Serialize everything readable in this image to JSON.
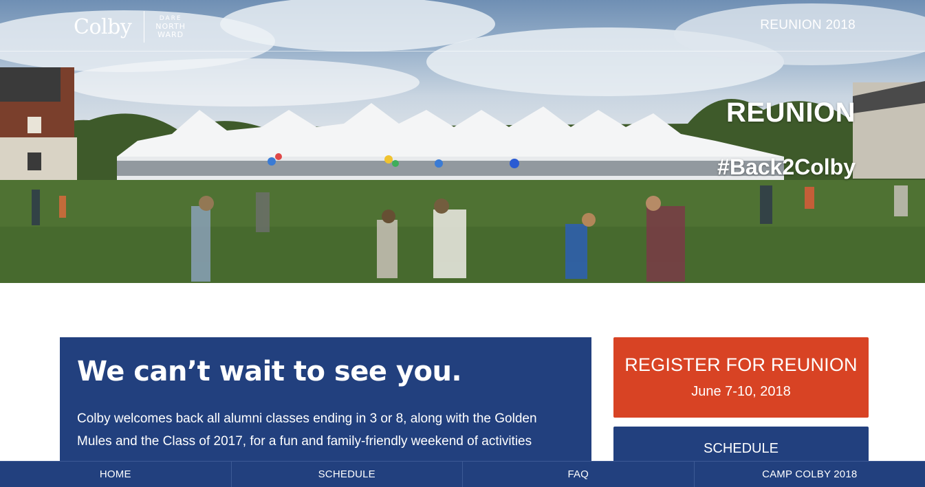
{
  "header": {
    "logo_name": "Colby",
    "logo_tagline": [
      "DARE",
      "NORTH",
      "WARD"
    ],
    "reunion_year": "REUNION 2018"
  },
  "hero": {
    "title": "REUNION",
    "hashtag": "#Back2Colby"
  },
  "welcome": {
    "heading": "We can’t wait to see you.",
    "body": "Colby welcomes back all alumni classes ending in 3 or 8, along with the Golden Mules and the Class of 2017, for a fun and family-friendly weekend of activities"
  },
  "cta": {
    "register_label": "REGISTER FOR REUNION",
    "register_dates": "June 7-10, 2018",
    "schedule_label": "SCHEDULE"
  },
  "bottom_nav": {
    "items": [
      {
        "label": "HOME"
      },
      {
        "label": "SCHEDULE"
      },
      {
        "label": "FAQ"
      },
      {
        "label": "CAMP COLBY 2018"
      }
    ]
  },
  "colors": {
    "brand_blue": "#22407e",
    "register_red": "#d84324"
  }
}
